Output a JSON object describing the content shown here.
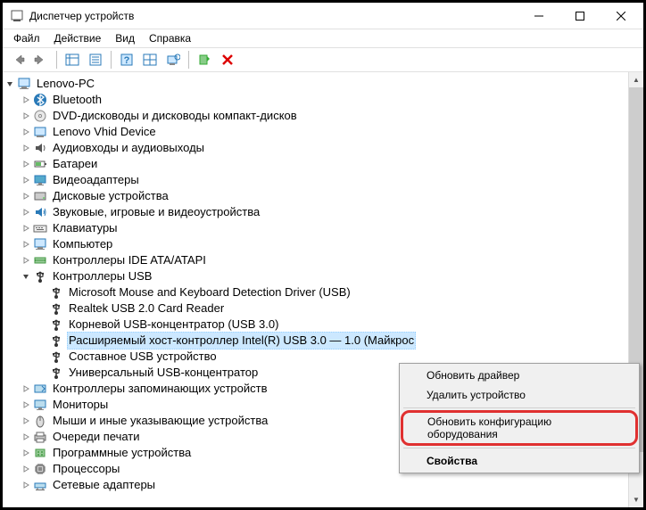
{
  "window": {
    "title": "Диспетчер устройств"
  },
  "menubar": {
    "file": "Файл",
    "action": "Действие",
    "view": "Вид",
    "help": "Справка"
  },
  "tree": {
    "root": "Lenovo-PC",
    "nodes": [
      {
        "label": "Bluetooth",
        "icon": "bluetooth"
      },
      {
        "label": "DVD-дисководы и дисководы компакт-дисков",
        "icon": "disc"
      },
      {
        "label": "Lenovo Vhid Device",
        "icon": "device"
      },
      {
        "label": "Аудиовходы и аудиовыходы",
        "icon": "audio"
      },
      {
        "label": "Батареи",
        "icon": "battery"
      },
      {
        "label": "Видеоадаптеры",
        "icon": "display"
      },
      {
        "label": "Дисковые устройства",
        "icon": "disk"
      },
      {
        "label": "Звуковые, игровые и видеоустройства",
        "icon": "sound"
      },
      {
        "label": "Клавиатуры",
        "icon": "keyboard"
      },
      {
        "label": "Компьютер",
        "icon": "computer"
      },
      {
        "label": "Контроллеры IDE ATA/ATAPI",
        "icon": "ide"
      },
      {
        "label": "Контроллеры USB",
        "icon": "usb",
        "expanded": true,
        "children": [
          {
            "label": "Microsoft Mouse and Keyboard Detection Driver (USB)",
            "icon": "usb"
          },
          {
            "label": "Realtek USB 2.0 Card Reader",
            "icon": "usb"
          },
          {
            "label": "Корневой USB-концентратор (USB 3.0)",
            "icon": "usb"
          },
          {
            "label": "Расширяемый хост-контроллер Intel(R) USB 3.0 — 1.0 (Майкрос",
            "icon": "usb",
            "selected": true
          },
          {
            "label": "Составное USB устройство",
            "icon": "usb"
          },
          {
            "label": "Универсальный USB-концентратор",
            "icon": "usb"
          }
        ]
      },
      {
        "label": "Контроллеры запоминающих устройств",
        "icon": "storage"
      },
      {
        "label": "Мониторы",
        "icon": "monitor"
      },
      {
        "label": "Мыши и иные указывающие устройства",
        "icon": "mouse"
      },
      {
        "label": "Очереди печати",
        "icon": "print"
      },
      {
        "label": "Программные устройства",
        "icon": "software"
      },
      {
        "label": "Процессоры",
        "icon": "cpu"
      },
      {
        "label": "Сетевые адаптеры",
        "icon": "network"
      }
    ]
  },
  "context_menu": {
    "update_driver": "Обновить драйвер",
    "remove": "Удалить устройство",
    "scan": "Обновить конфигурацию оборудования",
    "properties": "Свойства"
  }
}
